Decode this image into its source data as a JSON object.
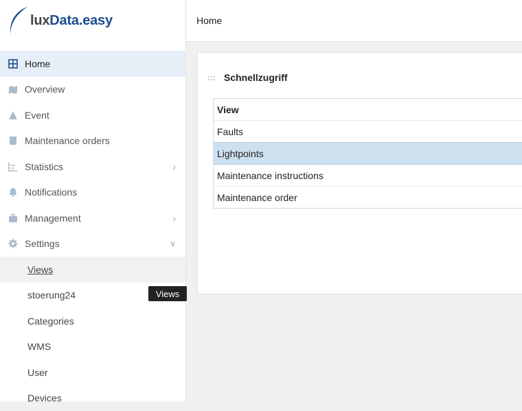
{
  "app": {
    "logo_prefix": "lux",
    "logo_suffix": "Data.easy"
  },
  "header": {
    "breadcrumb": "Home"
  },
  "sidebar": {
    "items": [
      {
        "label": "Home",
        "icon": "grid-icon",
        "active": true
      },
      {
        "label": "Overview",
        "icon": "map-icon"
      },
      {
        "label": "Event",
        "icon": "warning-icon"
      },
      {
        "label": "Maintenance orders",
        "icon": "clipboard-icon"
      },
      {
        "label": "Statistics",
        "icon": "chart-icon",
        "expandable": true
      },
      {
        "label": "Notifications",
        "icon": "bell-icon"
      },
      {
        "label": "Management",
        "icon": "briefcase-icon",
        "expandable": true
      },
      {
        "label": "Settings",
        "icon": "gear-icon",
        "expanded": true
      }
    ],
    "settings_sub": [
      "Views",
      "stoerung24",
      "Categories",
      "WMS",
      "User",
      "Devices"
    ],
    "tooltip": "Views"
  },
  "card": {
    "title": "Schnellzugriff",
    "table": {
      "header": "View",
      "rows": [
        "Faults",
        "Lightpoints",
        "Maintenance instructions",
        "Maintenance order"
      ],
      "selected_index": 1
    }
  },
  "colors": {
    "brand": "#1c4e8c",
    "active_nav": "#e6eef8",
    "selected_row": "#cde0f0",
    "icon": "#a9bbcc"
  }
}
